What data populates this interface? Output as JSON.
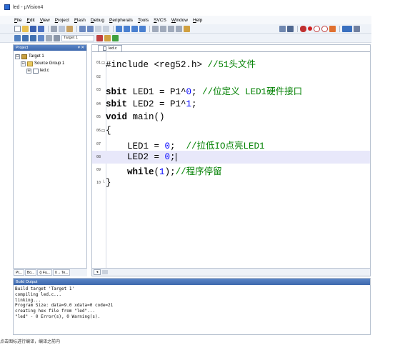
{
  "window": {
    "title": "led - µVision4"
  },
  "menu": [
    {
      "label": "File",
      "u": "F",
      "rest": "ile"
    },
    {
      "label": "Edit",
      "u": "E",
      "rest": "dit"
    },
    {
      "label": "View",
      "u": "V",
      "rest": "iew"
    },
    {
      "label": "Project",
      "u": "P",
      "rest": "roject"
    },
    {
      "label": "Flash",
      "u": "F",
      "rest": "lash"
    },
    {
      "label": "Debug",
      "u": "D",
      "rest": "ebug"
    },
    {
      "label": "Peripherals",
      "u": "P",
      "rest": "eripherals"
    },
    {
      "label": "Tools",
      "u": "T",
      "rest": "ools"
    },
    {
      "label": "SVCS",
      "u": "S",
      "rest": "VCS"
    },
    {
      "label": "Window",
      "u": "W",
      "rest": "indow"
    },
    {
      "label": "Help",
      "u": "H",
      "rest": "elp"
    }
  ],
  "toolbar": {
    "target": "Target 1"
  },
  "project_panel": {
    "title": "Project",
    "controls": "▾ ✕",
    "tree": [
      {
        "label": "Target 1",
        "expander": "⊟",
        "icon": "target",
        "indent": 0
      },
      {
        "label": "Source Group 1",
        "expander": "⊟",
        "icon": "folder",
        "indent": 1
      },
      {
        "label": "led.c",
        "expander": "⊞",
        "icon": "file",
        "indent": 2
      }
    ],
    "tabs": [
      "Pr...",
      "Bo...",
      "{} Fu...",
      "0→ Te..."
    ]
  },
  "editor": {
    "tab": "led.c",
    "lines": [
      {
        "num": "01",
        "fold": "⊟",
        "text": "#include <reg52.h> //51头文件"
      },
      {
        "num": "02",
        "fold": "",
        "text": ""
      },
      {
        "num": "03",
        "fold": "",
        "text": "sbit LED1 = P1^0; //位定义 LED1硬件接口"
      },
      {
        "num": "04",
        "fold": "",
        "text": "sbit LED2 = P1^1;"
      },
      {
        "num": "05",
        "fold": "",
        "text": "void main()"
      },
      {
        "num": "06",
        "fold": "⊟",
        "text": "{"
      },
      {
        "num": "07",
        "fold": "",
        "text": "    LED1 = 0;  //拉低IO点亮LED1"
      },
      {
        "num": "08",
        "fold": "",
        "text": "    LED2 = 0;"
      },
      {
        "num": "09",
        "fold": "",
        "text": "    while(1);//程序停留"
      },
      {
        "num": "10",
        "fold": "└",
        "text": "}"
      }
    ],
    "highlighted_line": "08"
  },
  "build_output": {
    "title": "Build Output",
    "lines": [
      "Build target 'Target 1'",
      "compiling led.c...",
      "linking...",
      "Program Size: data=9.0 xdata=0 code=21",
      "creating hex file from \"led\"...",
      "\"led\" - 0 Error(s), 0 Warning(s)."
    ]
  },
  "footer": "点击图标进行编译，编译之前内"
}
